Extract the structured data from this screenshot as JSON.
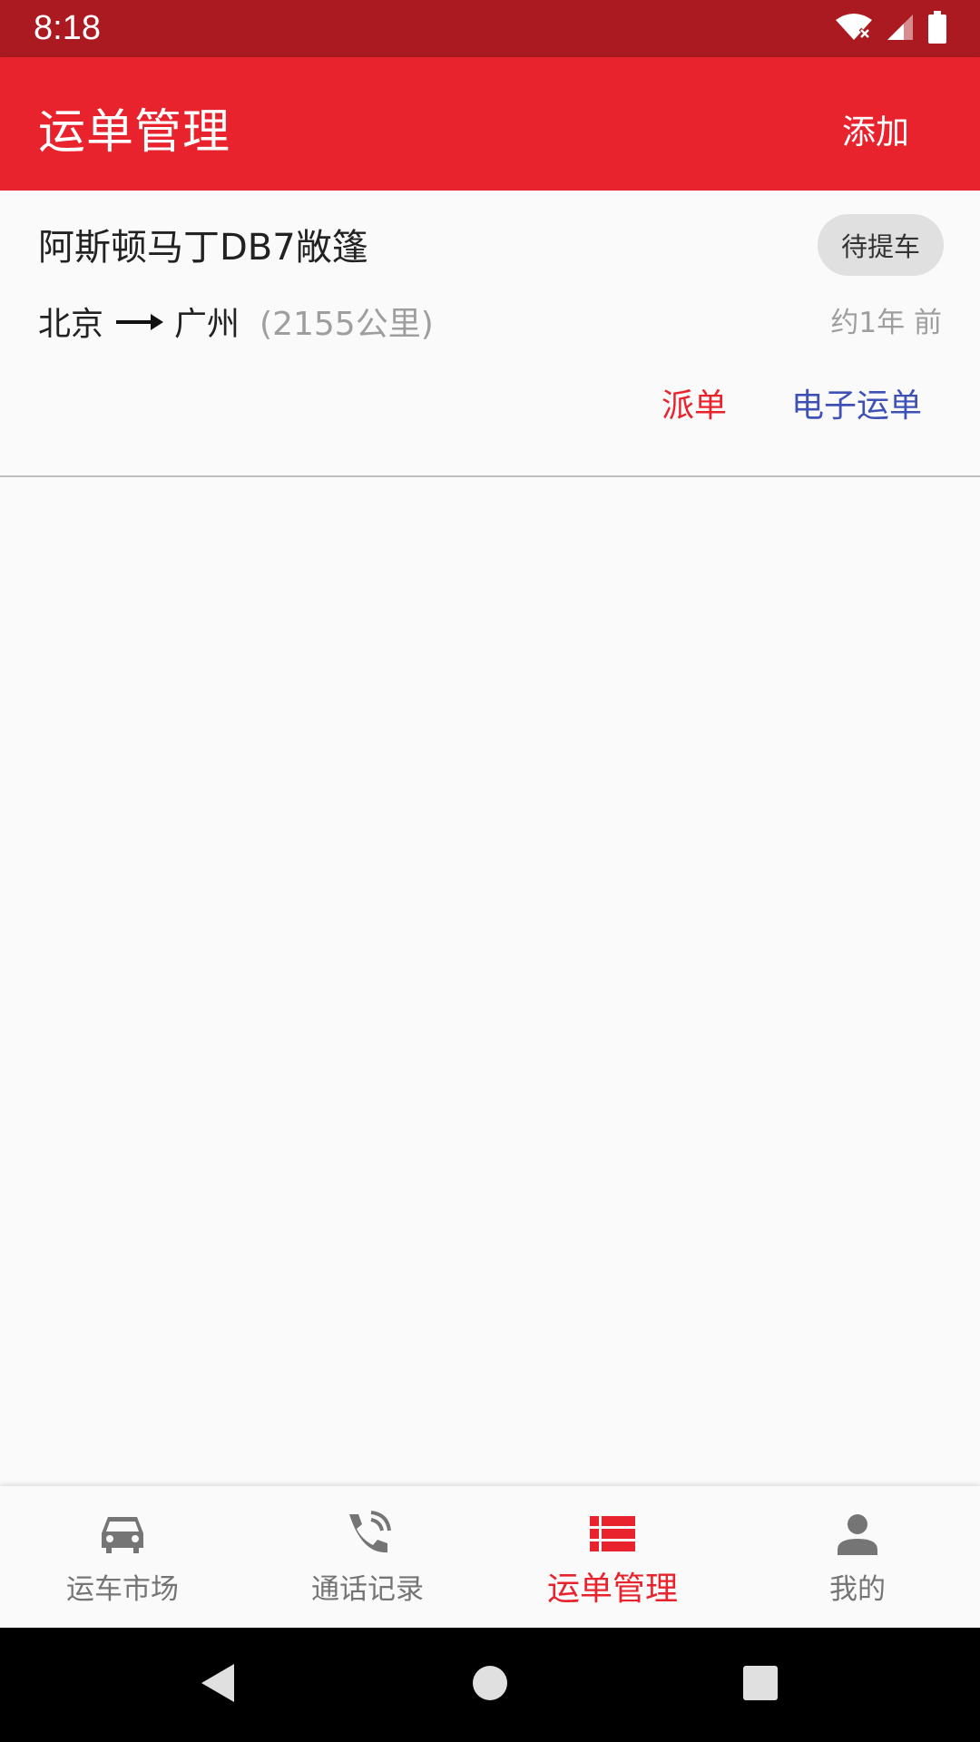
{
  "status_bar": {
    "time": "8:18"
  },
  "app_bar": {
    "title": "运单管理",
    "add_label": "添加"
  },
  "order": {
    "car_name": "阿斯顿马丁DB7敞篷",
    "status": "待提车",
    "origin": "北京",
    "destination": "广州",
    "distance": "(2155公里)",
    "time_ago": "约1年 前",
    "dispatch_label": "派单",
    "ewaybill_label": "电子运单"
  },
  "bottom_nav": {
    "items": [
      {
        "label": "运车市场",
        "icon": "car-icon"
      },
      {
        "label": "通话记录",
        "icon": "phone-icon"
      },
      {
        "label": "运单管理",
        "icon": "list-icon",
        "active": true
      },
      {
        "label": "我的",
        "icon": "person-icon"
      }
    ]
  },
  "colors": {
    "primary": "#e8232d",
    "status_bar": "#ab1a21",
    "link_blue": "#3f51b5",
    "muted": "#9e9e9e"
  }
}
